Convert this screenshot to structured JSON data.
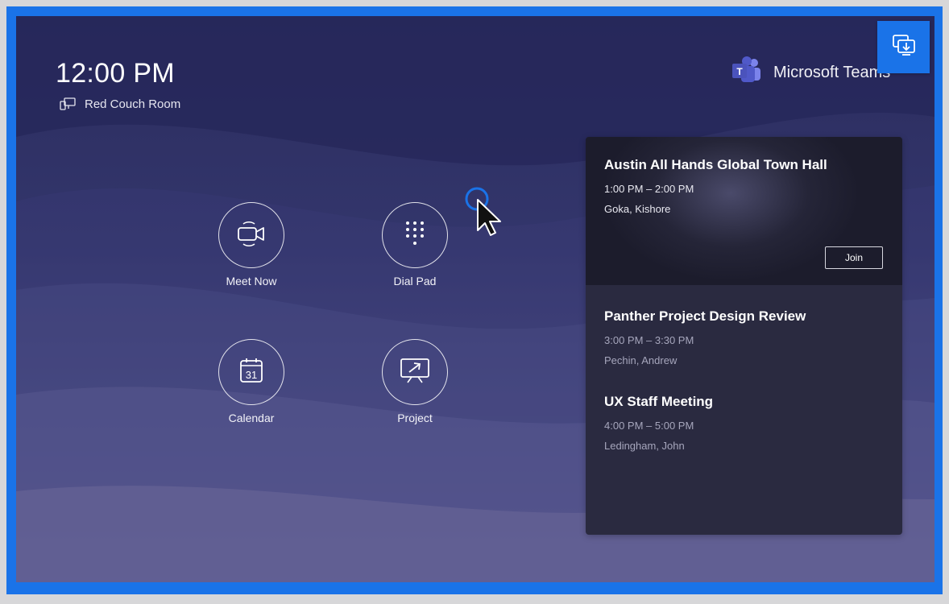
{
  "status": {
    "time": "12:00 PM",
    "room_name": "Red Couch Room"
  },
  "brand": {
    "name": "Microsoft Teams",
    "logo_letter": "T"
  },
  "actions": [
    {
      "label": "Meet Now",
      "icon": "video-camera-icon"
    },
    {
      "label": "Dial Pad",
      "icon": "dial-pad-icon"
    },
    {
      "label": "Calendar",
      "icon": "calendar-icon",
      "icon_text": "31"
    },
    {
      "label": "Project",
      "icon": "project-screen-icon"
    }
  ],
  "meetings": [
    {
      "title": "Austin All Hands Global Town Hall",
      "time": "1:00 PM – 2:00 PM",
      "attendees": "Goka, Kishore",
      "action_label": "Join"
    },
    {
      "title": "Panther Project Design Review",
      "time": "3:00 PM – 3:30 PM",
      "attendees": "Pechin, Andrew"
    },
    {
      "title": "UX Staff Meeting",
      "time": "4:00 PM – 5:00 PM",
      "attendees": "Ledingham, John"
    }
  ],
  "share_button": {
    "icon": "share-screen-icon"
  },
  "colors": {
    "accent": "#1a73e8",
    "background_top": "#2b2c5e",
    "background_bottom": "#625f94",
    "panel": "#2a2a40"
  }
}
